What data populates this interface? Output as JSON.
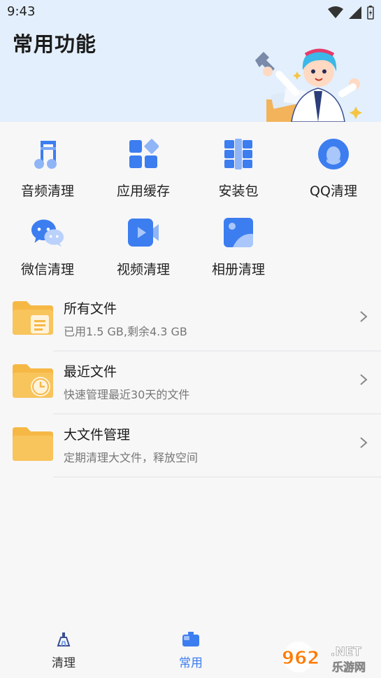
{
  "status": {
    "time": "9:43"
  },
  "header": {
    "title": "常用功能"
  },
  "grid": [
    {
      "label": "音频清理",
      "icon": "music-note-icon"
    },
    {
      "label": "应用缓存",
      "icon": "app-grid-icon"
    },
    {
      "label": "安装包",
      "icon": "package-icon"
    },
    {
      "label": "QQ清理",
      "icon": "qq-penguin-icon"
    },
    {
      "label": "微信清理",
      "icon": "wechat-icon"
    },
    {
      "label": "视频清理",
      "icon": "video-camera-icon"
    },
    {
      "label": "相册清理",
      "icon": "photo-album-icon"
    }
  ],
  "list": [
    {
      "title": "所有文件",
      "subtitle": "已用1.5 GB,剩余4.3 GB",
      "icon": "folder-document-icon"
    },
    {
      "title": "最近文件",
      "subtitle": "快速管理最近30天的文件",
      "icon": "folder-clock-icon"
    },
    {
      "title": "大文件管理",
      "subtitle": "定期清理大文件，释放空间",
      "icon": "folder-icon"
    }
  ],
  "tabs": [
    {
      "label": "清理",
      "active": false
    },
    {
      "label": "常用",
      "active": true
    }
  ],
  "watermark": {
    "number": "962",
    "suffix": ".NET",
    "cn": "乐游网"
  },
  "colors": {
    "accent": "#3c7df0",
    "header_bg": "#e3effc",
    "folder": "#f6b845"
  }
}
